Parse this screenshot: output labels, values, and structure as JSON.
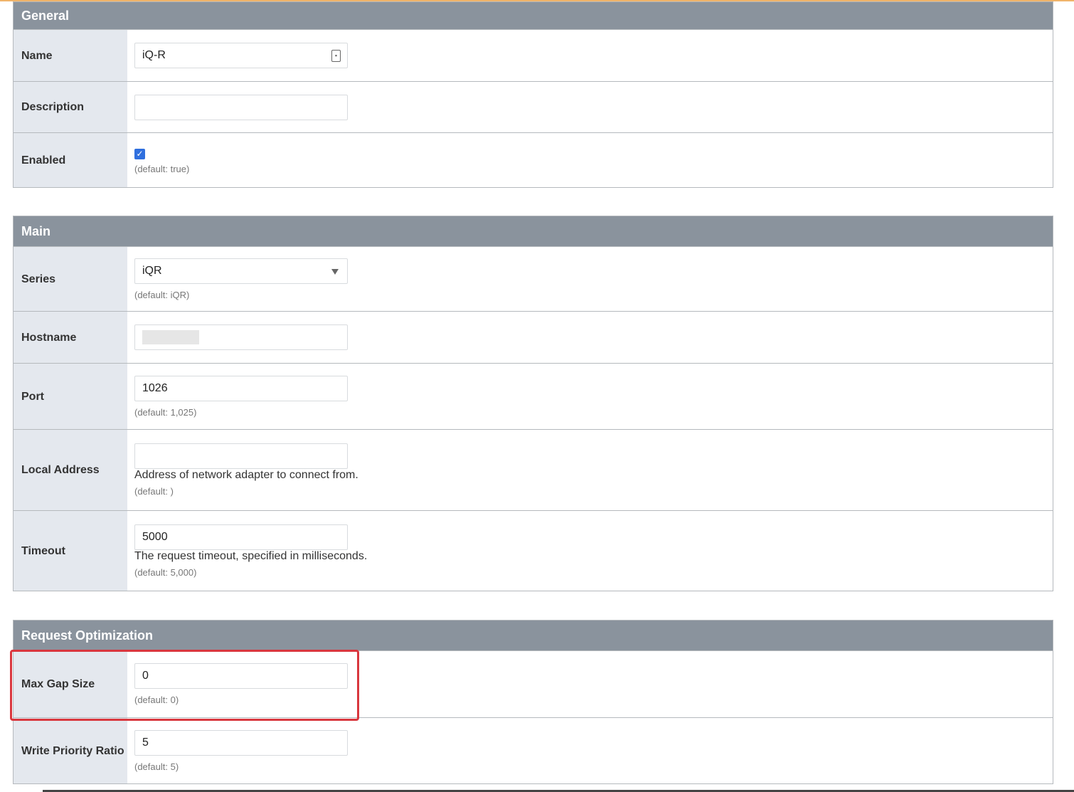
{
  "sections": {
    "general": {
      "title": "General",
      "name": {
        "label": "Name",
        "value": "iQ-R"
      },
      "description": {
        "label": "Description",
        "value": ""
      },
      "enabled": {
        "label": "Enabled",
        "checked": true,
        "hint": "(default: true)"
      }
    },
    "main": {
      "title": "Main",
      "series": {
        "label": "Series",
        "value": "iQR",
        "hint": "(default: iQR)"
      },
      "hostname": {
        "label": "Hostname"
      },
      "port": {
        "label": "Port",
        "value": "1026",
        "hint": "(default: 1,025)"
      },
      "local_address": {
        "label": "Local Address",
        "value": "",
        "description": "Address of network adapter to connect from.",
        "hint": "(default: )"
      },
      "timeout": {
        "label": "Timeout",
        "value": "5000",
        "description": "The request timeout, specified in milliseconds.",
        "hint": "(default: 5,000)"
      }
    },
    "request_optimization": {
      "title": "Request Optimization",
      "max_gap_size": {
        "label": "Max Gap Size",
        "value": "0",
        "hint": "(default: 0)"
      },
      "write_priority_ratio": {
        "label": "Write Priority Ratio",
        "value": "5",
        "hint": "(default: 5)"
      }
    }
  },
  "colors": {
    "header_bg": "#8a939d",
    "label_bg": "#e4e8ee",
    "highlight": "#d9373e",
    "checkbox": "#2f6fde"
  }
}
